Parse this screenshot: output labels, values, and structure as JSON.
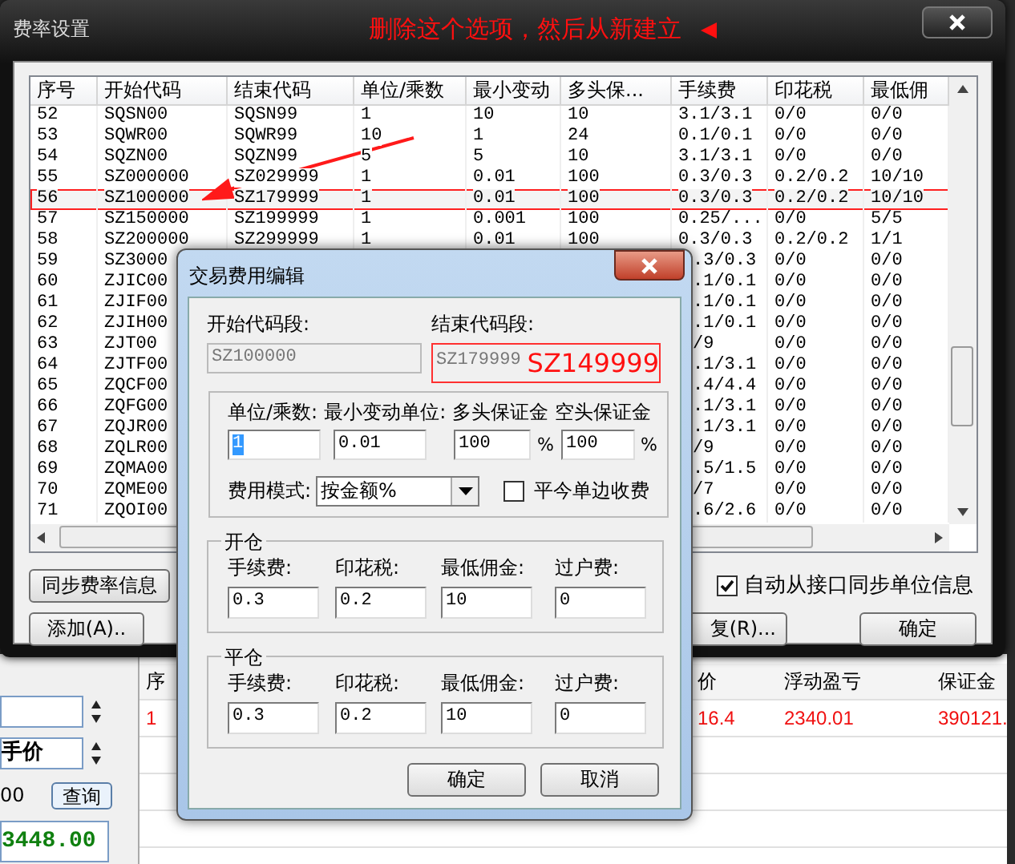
{
  "main_window": {
    "title": "费率设置",
    "annotation": "删除这个选项，然后从新建立",
    "table": {
      "columns": [
        "序号",
        "开始代码",
        "结束代码",
        "单位/乘数",
        "最小变动",
        "多头保...",
        "手续费",
        "印花税",
        "最低佣"
      ],
      "rows": [
        {
          "cells": [
            "52",
            "SQSN00",
            "SQSN99",
            "1",
            "10",
            "10",
            "3.1/3.1",
            "0/0",
            "0/0"
          ],
          "marked": false,
          "covered": false
        },
        {
          "cells": [
            "53",
            "SQWR00",
            "SQWR99",
            "10",
            "1",
            "24",
            "0.1/0.1",
            "0/0",
            "0/0"
          ],
          "marked": false,
          "covered": false
        },
        {
          "cells": [
            "54",
            "SQZN00",
            "SQZN99",
            "5",
            "5",
            "10",
            "3.1/3.1",
            "0/0",
            "0/0"
          ],
          "marked": false,
          "covered": false
        },
        {
          "cells": [
            "55",
            "SZ000000",
            "SZ029999",
            "1",
            "0.01",
            "100",
            "0.3/0.3",
            "0.2/0.2",
            "10/10"
          ],
          "marked": false,
          "covered": false
        },
        {
          "cells": [
            "56",
            "SZ100000",
            "SZ179999",
            "1",
            "0.01",
            "100",
            "0.3/0.3",
            "0.2/0.2",
            "10/10"
          ],
          "marked": true,
          "covered": false
        },
        {
          "cells": [
            "57",
            "SZ150000",
            "SZ199999",
            "1",
            "0.001",
            "100",
            "0.25/...",
            "0/0",
            "5/5"
          ],
          "marked": false,
          "covered": false
        },
        {
          "cells": [
            "58",
            "SZ200000",
            "SZ299999",
            "1",
            "0.01",
            "100",
            "0.3/0.3",
            "0.2/0.2",
            "1/1"
          ],
          "marked": false,
          "covered": false
        },
        {
          "cells": [
            "59",
            "SZ3000",
            ".3/0.3",
            "0/0",
            "0/0"
          ],
          "marked": false,
          "covered": true
        },
        {
          "cells": [
            "60",
            "ZJIC00",
            ".1/0.1",
            "0/0",
            "0/0"
          ],
          "marked": false,
          "covered": true
        },
        {
          "cells": [
            "61",
            "ZJIF00",
            ".1/0.1",
            "0/0",
            "0/0"
          ],
          "marked": false,
          "covered": true
        },
        {
          "cells": [
            "62",
            "ZJIH00",
            ".1/0.1",
            "0/0",
            "0/0"
          ],
          "marked": false,
          "covered": true
        },
        {
          "cells": [
            "63",
            "ZJT00",
            "/9",
            "0/0",
            "0/0"
          ],
          "marked": false,
          "covered": true
        },
        {
          "cells": [
            "64",
            "ZJTF00",
            ".1/3.1",
            "0/0",
            "0/0"
          ],
          "marked": false,
          "covered": true
        },
        {
          "cells": [
            "65",
            "ZQCF00",
            ".4/4.4",
            "0/0",
            "0/0"
          ],
          "marked": false,
          "covered": true
        },
        {
          "cells": [
            "66",
            "ZQFG00",
            ".1/3.1",
            "0/0",
            "0/0"
          ],
          "marked": false,
          "covered": true
        },
        {
          "cells": [
            "67",
            "ZQJR00",
            ".1/3.1",
            "0/0",
            "0/0"
          ],
          "marked": false,
          "covered": true
        },
        {
          "cells": [
            "68",
            "ZQLR00",
            "/9",
            "0/0",
            "0/0"
          ],
          "marked": false,
          "covered": true
        },
        {
          "cells": [
            "69",
            "ZQMA00",
            ".5/1.5",
            "0/0",
            "0/0"
          ],
          "marked": false,
          "covered": true
        },
        {
          "cells": [
            "70",
            "ZQME00",
            "/7",
            "0/0",
            "0/0"
          ],
          "marked": false,
          "covered": true
        },
        {
          "cells": [
            "71",
            "ZQOI00",
            ".6/2.6",
            "0/0",
            "0/0"
          ],
          "marked": false,
          "covered": true
        }
      ]
    },
    "sync_button": "同步费率信息",
    "add_button": "添加(A)..",
    "restore_button": "复(R)...",
    "auto_sync": {
      "label": "自动从接口同步单位信息",
      "checked": true
    },
    "ok_button": "确定"
  },
  "dialog": {
    "title": "交易费用编辑",
    "start_label": "开始代码段:",
    "start_value": "SZ100000",
    "end_label": "结束代码段:",
    "end_value": "SZ179999",
    "end_note": "SZ149999",
    "params": [
      {
        "label": "单位/乘数:",
        "value": "1",
        "text_selected": true
      },
      {
        "label": "最小变动单位:",
        "value": "0.01",
        "text_selected": false
      },
      {
        "label": "多头保证金",
        "value": "100",
        "unit": "%",
        "text_selected": false
      },
      {
        "label": "空头保证金",
        "value": "100",
        "unit": "%",
        "text_selected": false
      }
    ],
    "fee_mode": {
      "label": "费用模式:",
      "value": "按金额%"
    },
    "one_side": {
      "label": "平今单边收费",
      "checked": false
    },
    "sections": [
      {
        "title": "开仓",
        "fields": [
          {
            "label": "手续费:",
            "value": "0.3"
          },
          {
            "label": "印花税:",
            "value": "0.2"
          },
          {
            "label": "最低佣金:",
            "value": "10"
          },
          {
            "label": "过户费:",
            "value": "0"
          }
        ]
      },
      {
        "title": "平仓",
        "fields": [
          {
            "label": "手续费:",
            "value": "0.3"
          },
          {
            "label": "印花税:",
            "value": "0.2"
          },
          {
            "label": "最低佣金:",
            "value": "10"
          },
          {
            "label": "过户费:",
            "value": "0"
          }
        ]
      }
    ],
    "buttons": [
      "确定",
      "取消"
    ]
  },
  "trade_panel": {
    "price_mode": "手价",
    "amount": "00",
    "query_button": "查询",
    "price": "3448.00"
  },
  "positions": {
    "columns": [
      "序",
      "价",
      "浮动盈亏",
      "保证金"
    ],
    "rows": [
      [
        "1",
        "16.4",
        "2340.01",
        "390121."
      ]
    ]
  }
}
